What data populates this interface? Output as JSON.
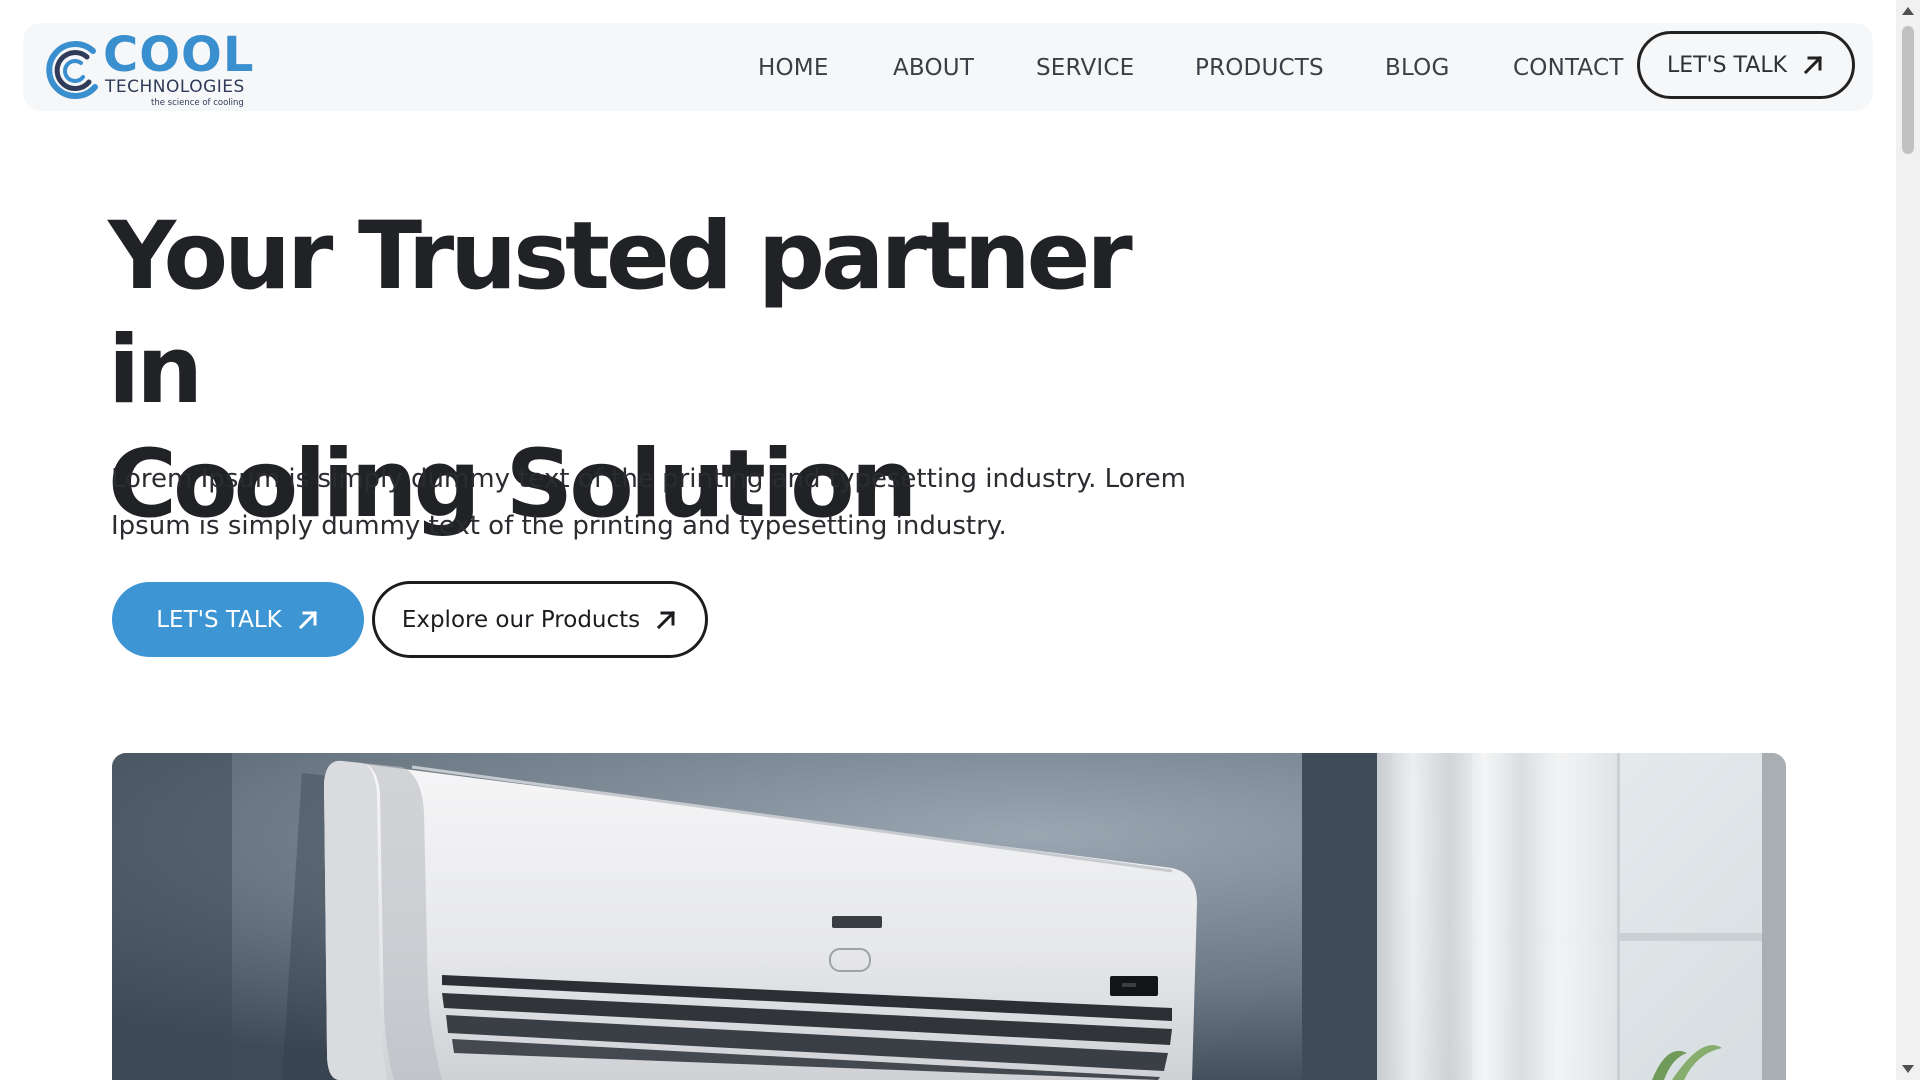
{
  "brand": {
    "name_primary": "COOL",
    "name_secondary": "TECHNOLOGIES",
    "tagline": "the science of cooling",
    "accent_color": "#3d95d4",
    "dark_color": "#2f3b58"
  },
  "nav": {
    "items": [
      {
        "label": "HOME"
      },
      {
        "label": "ABOUT"
      },
      {
        "label": "SERVICE"
      },
      {
        "label": "PRODUCTS"
      },
      {
        "label": "BLOG"
      },
      {
        "label": "CONTACT"
      }
    ],
    "cta_label": "LET'S TALK",
    "cta_icon": "arrow-up-right-icon"
  },
  "hero": {
    "title_line1": "Your Trusted partner in",
    "title_line2": "Cooling Solution",
    "description": "Lorem Ipsum is simply dummy text of the printing and typesetting industry. Lorem Ipsum is simply dummy text of the printing and typesetting industry.",
    "primary_button_label": "LET'S TALK",
    "secondary_button_label": "Explore our Products",
    "button_icon": "arrow-up-right-icon",
    "image_subject": "wall-mounted-air-conditioner"
  }
}
